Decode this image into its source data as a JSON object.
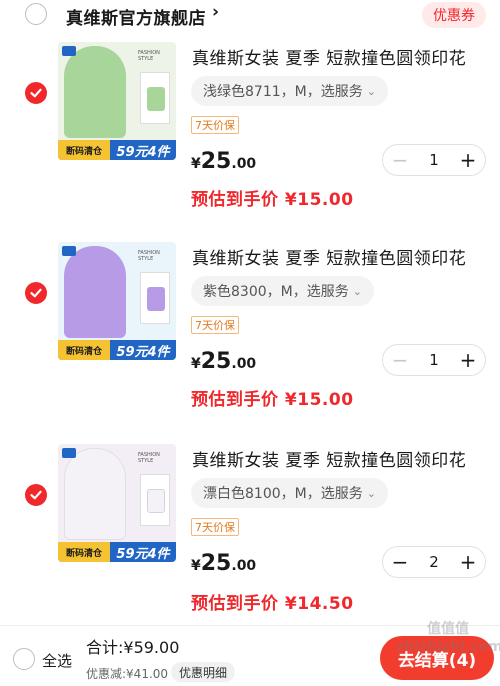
{
  "store": {
    "name": "真维斯官方旗舰店",
    "arrow": "›",
    "coupon_label": "优惠券"
  },
  "items": [
    {
      "title": "真维斯女装 夏季 短款撞色圆领印花",
      "sku": "浅绿色8711，M，选服务",
      "tag": "7天价保",
      "price_yen": "¥",
      "price_int": "25",
      "price_dec": ".00",
      "est_price": "预估到手价 ¥15.00",
      "quantity": "1",
      "thumb_style_text": "FASHION STYLE",
      "promo_left": "断码清仓",
      "promo_right": "59元4件",
      "shirt_color": "#a8d59a",
      "checked": true
    },
    {
      "title": "真维斯女装 夏季 短款撞色圆领印花",
      "sku": "紫色8300，M，选服务",
      "tag": "7天价保",
      "price_yen": "¥",
      "price_int": "25",
      "price_dec": ".00",
      "est_price": "预估到手价 ¥15.00",
      "quantity": "1",
      "thumb_style_text": "FASHION STYLE",
      "promo_left": "断码清仓",
      "promo_right": "59元4件",
      "shirt_color": "#b79be6",
      "checked": true
    },
    {
      "title": "真维斯女装 夏季 短款撞色圆领印花",
      "sku": "漂白色8100，M，选服务",
      "tag": "7天价保",
      "price_yen": "¥",
      "price_int": "25",
      "price_dec": ".00",
      "est_price": "预估到手价 ¥14.50",
      "quantity": "2",
      "thumb_style_text": "FASHION STYLE",
      "promo_left": "断码清仓",
      "promo_right": "59元4件",
      "shirt_color": "#f4f2f6",
      "checked": true
    }
  ],
  "footer": {
    "select_all": "全选",
    "total": "合计:¥59.00",
    "discount": "优惠减:¥41.00",
    "detail": "优惠明细",
    "checkout": "去结算(4)"
  },
  "colors": {
    "accent": "#f0282c",
    "checkout": "#f23c2e",
    "tag_border": "#f4b878"
  },
  "watermark": "值值值 zhizhizhi.com"
}
